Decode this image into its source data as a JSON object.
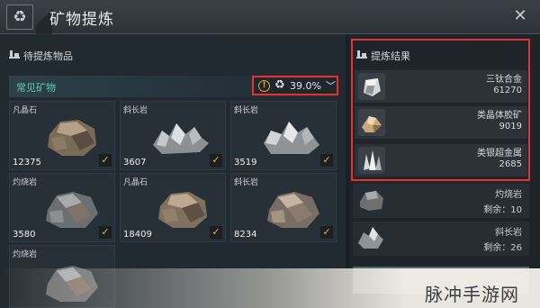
{
  "header": {
    "title": "矿物提炼",
    "recycle_icon": "recycle-icon",
    "close_icon": "close-icon"
  },
  "pending": {
    "title": "待提炼物品",
    "category": "常见矿物",
    "filter": {
      "percent": "39.0%",
      "warn": "!"
    },
    "ores": [
      {
        "name": "凡晶石",
        "count": "12375",
        "checked": true
      },
      {
        "name": "斜长岩",
        "count": "3607",
        "checked": true
      },
      {
        "name": "斜长岩",
        "count": "3519",
        "checked": true
      },
      {
        "name": "灼烧岩",
        "count": "3580",
        "checked": true
      },
      {
        "name": "凡晶石",
        "count": "18409",
        "checked": true
      },
      {
        "name": "斜长岩",
        "count": "8234",
        "checked": true
      },
      {
        "name": "灼烧岩",
        "count": "",
        "checked": false
      }
    ]
  },
  "results": {
    "title": "提炼结果",
    "items": [
      {
        "name": "三钛合金",
        "value": "61270"
      },
      {
        "name": "类晶体胶矿",
        "value": "9019"
      },
      {
        "name": "类银超金属",
        "value": "2685"
      }
    ]
  },
  "remaining": [
    {
      "name": "灼烧岩",
      "value": "剩余：10"
    },
    {
      "name": "斜长岩",
      "value": "剩余：26"
    }
  ],
  "watermark": "脉冲手游网",
  "colors": {
    "accent_teal": "#5fc7b8",
    "highlight_red": "#e3322f",
    "check_gold": "#f1b12f"
  }
}
